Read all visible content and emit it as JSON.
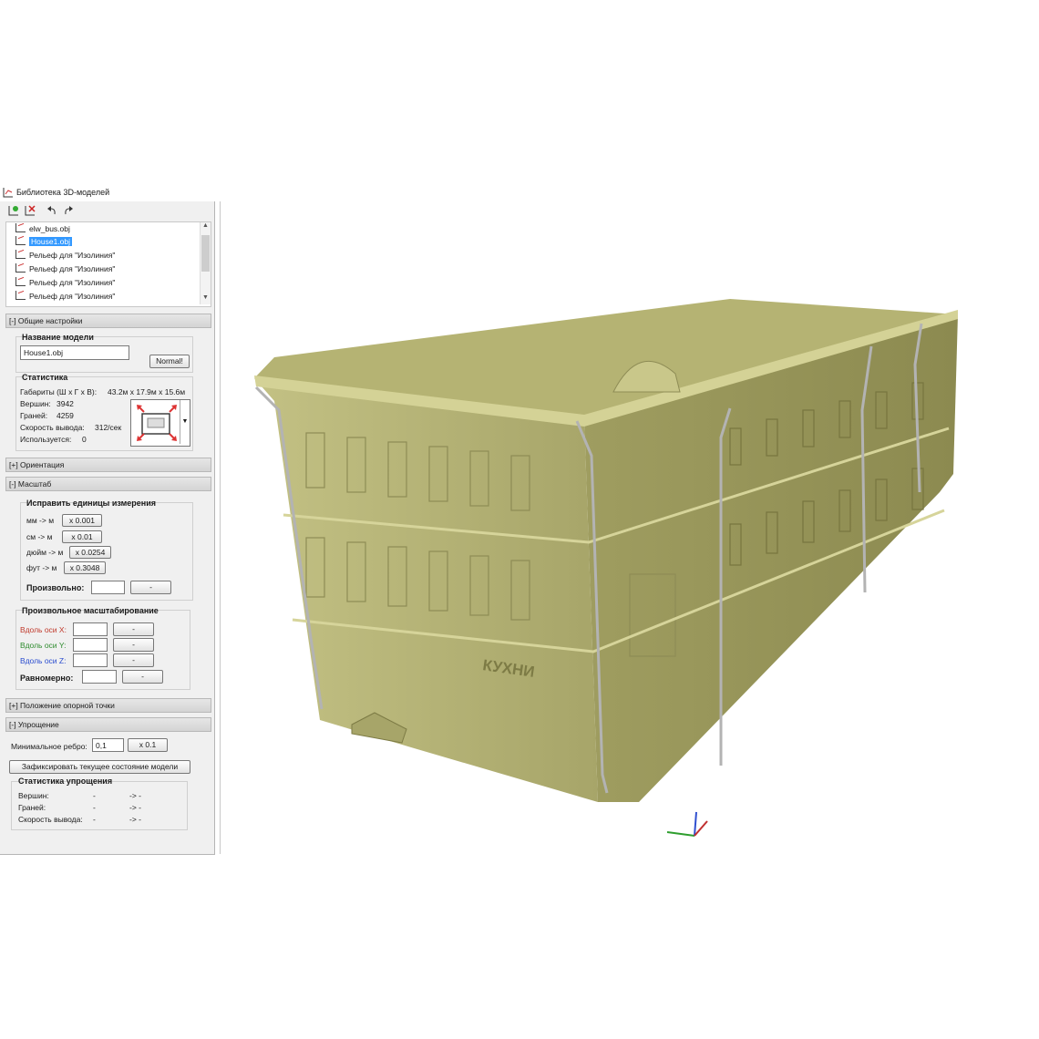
{
  "window": {
    "title": "Библиотека 3D-моделей"
  },
  "toolbar": {
    "icons": [
      "add-model-icon",
      "remove-model-icon",
      "undo-icon",
      "redo-icon"
    ]
  },
  "tree": {
    "items": [
      {
        "label": "elw_bus.obj",
        "selected": false
      },
      {
        "label": "House1.obj",
        "selected": true
      },
      {
        "label": "Рельеф для \"Изолиния\"",
        "selected": false
      },
      {
        "label": "Рельеф для \"Изолиния\"",
        "selected": false
      },
      {
        "label": "Рельеф для \"Изолиния\"",
        "selected": false
      },
      {
        "label": "Рельеф для \"Изолиния\"",
        "selected": false
      }
    ]
  },
  "general": {
    "header": "[-] Общие настройки",
    "name_group": "Название модели",
    "model_name": "House1.obj",
    "normal_button": "Normal!",
    "stats_group": "Статистика",
    "dims_label": "Габариты (Ш х Г х В):",
    "dims_value": "43.2м x 17.9м x 15.6м",
    "vertices_label": "Вершин:",
    "vertices_value": "3942",
    "faces_label": "Граней:",
    "faces_value": "4259",
    "speed_label": "Скорость вывода:",
    "speed_value": "312/сек",
    "used_label": "Используется:",
    "used_value": "0"
  },
  "orientation": {
    "header": "[+] Ориентация"
  },
  "scale": {
    "header": "[-] Масштаб",
    "fix_group": "Исправить единицы измерения",
    "rows": [
      {
        "label": "мм -> м",
        "button": "x 0.001"
      },
      {
        "label": "см -> м",
        "button": "x 0.01"
      },
      {
        "label": "дюйм -> м",
        "button": "x 0.0254"
      },
      {
        "label": "фут -> м",
        "button": "x 0.3048"
      }
    ],
    "arbitrary_label": "Произвольно:",
    "dash": "-",
    "free_group": "Произвольное масштабирование",
    "axis_x": "Вдоль оси X:",
    "axis_y": "Вдоль оси Y:",
    "axis_z": "Вдоль оси Z:",
    "uniform": "Равномерно:"
  },
  "pivot": {
    "header": "[+] Положение опорной точки"
  },
  "simplify": {
    "header": "[-] Упрощение",
    "min_edge_label": "Минимальное ребро:",
    "min_edge_value": "0,1",
    "min_edge_button": "x 0.1",
    "fix_button": "Зафиксировать текущее состояние модели",
    "stats_group": "Статистика упрощения",
    "vertices_label": "Вершин:",
    "faces_label": "Граней:",
    "speed_label": "Скорость вывода:",
    "dash": "-",
    "arrow": "-> -"
  },
  "viewport": {
    "sign_text": "КУХНИ",
    "model_color": "#b9b777",
    "axis_colors": {
      "x": "#2e9e2e",
      "y": "#3050d0",
      "z": "#c03030"
    }
  }
}
